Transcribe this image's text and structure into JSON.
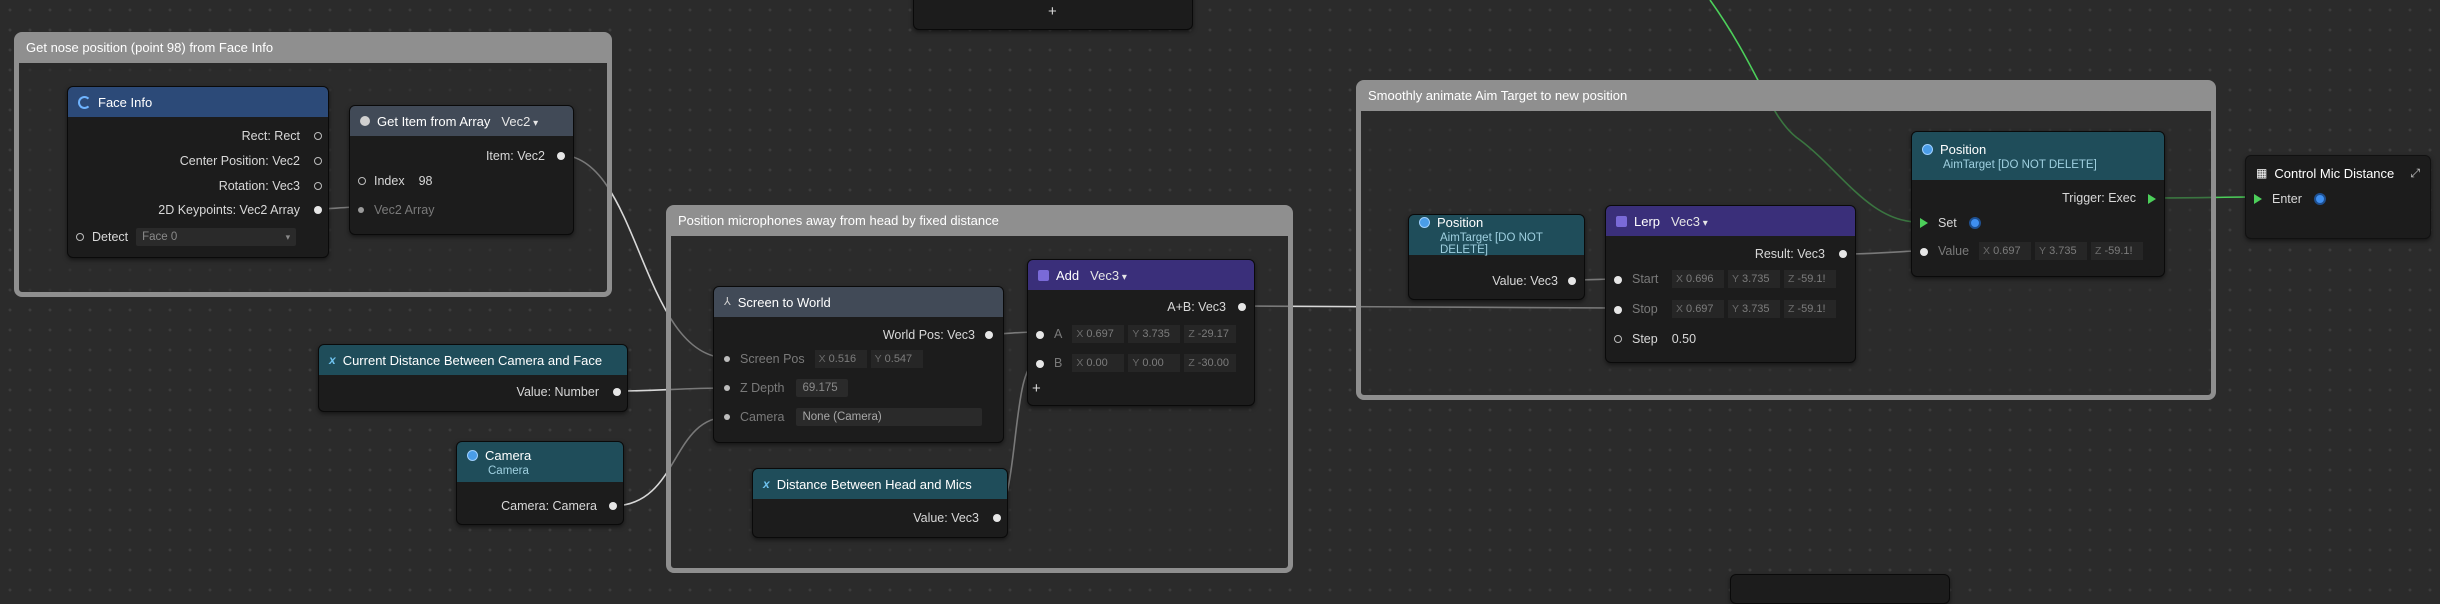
{
  "groups": {
    "nose": "Get nose position (point 98) from Face Info",
    "position": "Position microphones away from head by fixed distance",
    "smooth": "Smoothly animate Aim Target to new position"
  },
  "top_node": {
    "plus": "+"
  },
  "face_info": {
    "title": "Face Info",
    "outputs": [
      "Rect: Rect",
      "Center Position: Vec2",
      "Rotation: Vec3",
      "2D Keypoints: Vec2 Array"
    ],
    "detect_label": "Detect",
    "detect_value": "Face 0"
  },
  "get_item": {
    "title": "Get Item from Array",
    "type": "Vec2",
    "output": "Item: Vec2",
    "index_label": "Index",
    "index_value": "98",
    "array_label": "Vec2 Array"
  },
  "current_distance": {
    "title": "Current Distance Between Camera and Face",
    "output": "Value: Number"
  },
  "camera_node": {
    "title": "Camera",
    "subtitle": "Camera",
    "output": "Camera: Camera"
  },
  "screen_to_world": {
    "title": "Screen to World",
    "output": "World Pos: Vec3",
    "screen_pos_label": "Screen Pos",
    "screen_pos": {
      "x_label": "X",
      "x": "0.516",
      "y_label": "Y",
      "y": "0.547"
    },
    "z_depth_label": "Z Depth",
    "z_depth": "69.175",
    "camera_label": "Camera",
    "camera_value": "None (Camera)"
  },
  "add_node": {
    "title": "Add",
    "type": "Vec3",
    "output": "A+B: Vec3",
    "a_label": "A",
    "a": {
      "x": "0.697",
      "y": "3.735",
      "z": "-29.17"
    },
    "b_label": "B",
    "b": {
      "x": "0.00",
      "y": "0.00",
      "z": "-30.00"
    },
    "plus": "+"
  },
  "distance_head_mics": {
    "title": "Distance Between Head and Mics",
    "output": "Value: Vec3"
  },
  "position_read": {
    "title": "Position",
    "subtitle": "AimTarget [DO NOT DELETE]",
    "output": "Value: Vec3"
  },
  "lerp": {
    "title": "Lerp",
    "type": "Vec3",
    "output": "Result: Vec3",
    "start_label": "Start",
    "start": {
      "x": "0.696",
      "y": "3.735",
      "z": "-59.1!"
    },
    "stop_label": "Stop",
    "stop": {
      "x": "0.697",
      "y": "3.735",
      "z": "-59.1!"
    },
    "step_label": "Step",
    "step_value": "0.50"
  },
  "position_set": {
    "title": "Position",
    "subtitle": "AimTarget [DO NOT DELETE]",
    "trigger": "Trigger: Exec",
    "set_label": "Set",
    "value_label": "Value",
    "value": {
      "x": "0.697",
      "y": "3.735",
      "z": "-59.1!"
    }
  },
  "control_mic": {
    "title": "Control Mic Distance",
    "enter_label": "Enter"
  },
  "axis_labels": {
    "x": "X",
    "y": "Y",
    "z": "Z"
  },
  "colors": {
    "canvas": "#2b2b2b",
    "group_border": "#8f8f8f",
    "exec_wire": "#4ccf5a",
    "data_wire": "#d8d8d8",
    "header_blue": "#2c4a78",
    "header_purple": "#3a2f7a",
    "header_teal": "#1f4d5a"
  },
  "icons": [
    "face-icon",
    "gear-icon",
    "variable-x-icon",
    "camera-dot-icon",
    "tree-icon",
    "math-square-icon",
    "grid-icon",
    "expand-icon"
  ]
}
